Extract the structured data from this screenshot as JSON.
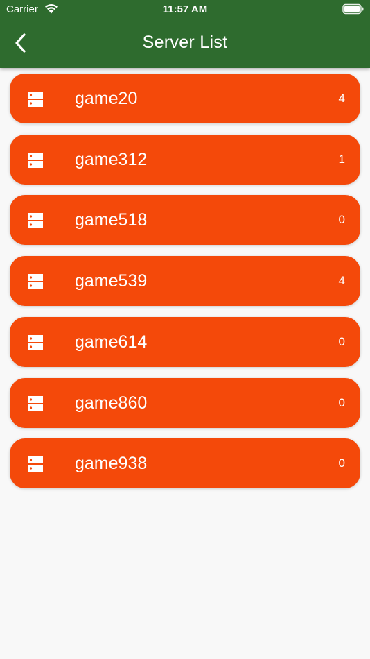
{
  "status_bar": {
    "carrier": "Carrier",
    "time": "11:57 AM"
  },
  "app_bar": {
    "title": "Server List",
    "back_icon": "chevron-left-icon"
  },
  "colors": {
    "app_bar_background": "#2e6b2e",
    "item_background": "#f4490a",
    "page_background": "#f8f8f8",
    "text_on_accent": "#ffffff"
  },
  "servers": [
    {
      "name": "game20",
      "count": "4",
      "icon": "server-icon"
    },
    {
      "name": "game312",
      "count": "1",
      "icon": "server-icon"
    },
    {
      "name": "game518",
      "count": "0",
      "icon": "server-icon"
    },
    {
      "name": "game539",
      "count": "4",
      "icon": "server-icon"
    },
    {
      "name": "game614",
      "count": "0",
      "icon": "server-icon"
    },
    {
      "name": "game860",
      "count": "0",
      "icon": "server-icon"
    },
    {
      "name": "game938",
      "count": "0",
      "icon": "server-icon"
    }
  ]
}
